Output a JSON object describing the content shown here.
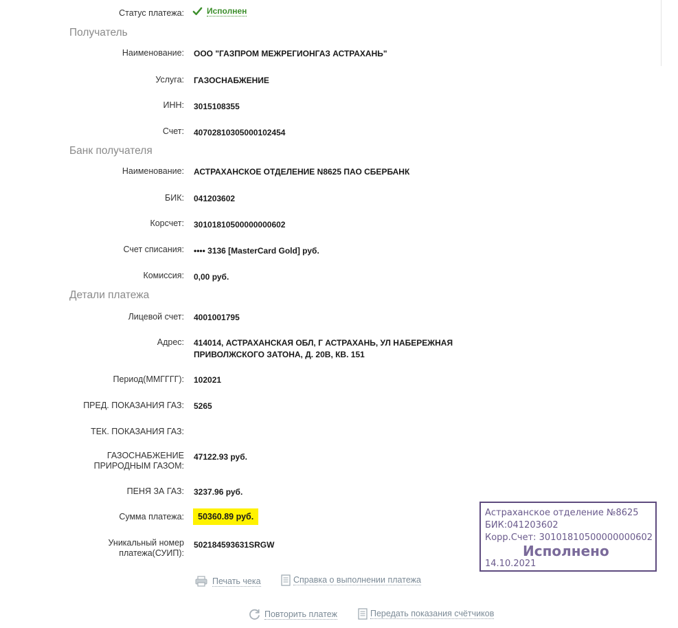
{
  "status": {
    "label": "Статус платежа:",
    "value": "Исполнен",
    "icon": "check-icon",
    "color": "#3d8f2c"
  },
  "sections": {
    "recipient": "Получатель",
    "bank": "Банк получателя",
    "details": "Детали платежа"
  },
  "recipient": {
    "name_label": "Наименование:",
    "name_value": "ООО \"ГАЗПРОМ МЕЖРЕГИОНГАЗ АСТРАХАНЬ\"",
    "service_label": "Услуга:",
    "service_value": "ГАЗОСНАБЖЕНИЕ",
    "inn_label": "ИНН:",
    "inn_value": "3015108355",
    "account_label": "Счет:",
    "account_value": "40702810305000102454"
  },
  "bank": {
    "name_label": "Наименование:",
    "name_value": "АСТРАХАНСКОЕ ОТДЕЛЕНИЕ N8625 ПАО СБЕРБАНК",
    "bik_label": "БИК:",
    "bik_value": "041203602",
    "corr_label": "Корсчет:",
    "corr_value": "30101810500000000602",
    "debit_label": "Счет списания:",
    "debit_value": "•••• 3136  [MasterCard Gold]  руб.",
    "fee_label": "Комиссия:",
    "fee_value": "0,00 руб."
  },
  "details": {
    "personal_label": "Лицевой счет:",
    "personal_value": "4001001795",
    "address_label": "Адрес:",
    "address_line1": "414014, АСТРАХАНСКАЯ ОБЛ, Г АСТРАХАНЬ, УЛ НАБЕРЕЖНАЯ",
    "address_line2": "ПРИВОЛЖСКОГО ЗАТОНА, Д. 20В, КВ. 151",
    "period_label": "Период(ММГГГГ):",
    "period_value": "102021",
    "prev_label": "ПРЕД. ПОКАЗАНИЯ ГАЗ:",
    "prev_value": "5265",
    "cur_label": "ТЕК. ПОКАЗАНИЯ ГАЗ:",
    "cur_value": "",
    "gas_label_line1": "ГАЗОСНАБЖЕНИЕ",
    "gas_label_line2": "ПРИРОДНЫМ ГАЗОМ:",
    "gas_value": "47122.93 руб.",
    "penalty_label": "ПЕНЯ ЗА ГАЗ:",
    "penalty_value": "3237.96 руб.",
    "sum_label": "Сумма платежа:",
    "sum_value": "50360.89 руб.",
    "suip_label_line1": "Уникальный номер",
    "suip_label_line2": "платежа(СУИП):",
    "suip_value": "502184593631SRGW"
  },
  "actions": {
    "print": {
      "label": "Печать чека",
      "icon": "printer-icon"
    },
    "certificate": {
      "label": "Справка о выполнении платежа",
      "icon": "document-icon"
    },
    "repeat": {
      "label": "Повторить платеж",
      "icon": "refresh-icon"
    },
    "meters": {
      "label": "Передать показания счётчиков",
      "icon": "document-icon"
    }
  },
  "stamp": {
    "line1": "Астраханское отделение №8625",
    "line2": "БИК:041203602",
    "line3": "Корр.Счет: 30101810500000000602",
    "status": "Исполнено",
    "date": "14.10.2021",
    "color": "#6a5a8c"
  },
  "colors": {
    "highlight": "#fff200",
    "section": "#8a8a8a",
    "link": "#7b8a96"
  }
}
